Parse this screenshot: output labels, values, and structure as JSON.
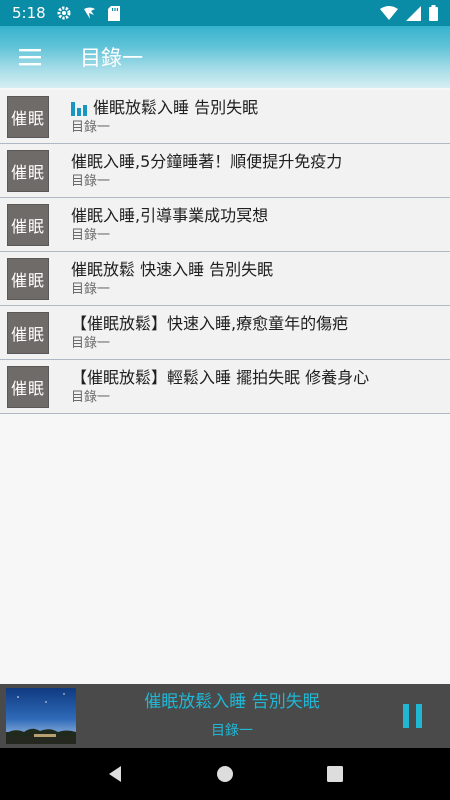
{
  "status_bar": {
    "time": "5:18",
    "icons": [
      "gear-icon",
      "bird-icon",
      "sd-card-icon",
      "wifi-icon",
      "signal-icon",
      "battery-icon"
    ]
  },
  "app_bar": {
    "title": "目錄一",
    "menu_icon": "hamburger-icon"
  },
  "list": {
    "items": [
      {
        "thumb": "催眠",
        "title": "催眠放鬆入睡 告別失眠",
        "subtitle": "目錄一",
        "playing": true
      },
      {
        "thumb": "催眠",
        "title": "催眠入睡,5分鐘睡著！順便提升免疫力",
        "subtitle": "目錄一",
        "playing": false
      },
      {
        "thumb": "催眠",
        "title": "催眠入睡,引導事業成功冥想",
        "subtitle": "目錄一",
        "playing": false
      },
      {
        "thumb": "催眠",
        "title": "催眠放鬆 快速入睡 告別失眠",
        "subtitle": "目錄一",
        "playing": false
      },
      {
        "thumb": "催眠",
        "title": "【催眠放鬆】快速入睡,療愈童年的傷疤",
        "subtitle": "目錄一",
        "playing": false
      },
      {
        "thumb": "催眠",
        "title": "【催眠放鬆】輕鬆入睡 擺拍失眠 修養身心",
        "subtitle": "目錄一",
        "playing": false
      }
    ]
  },
  "player": {
    "title": "催眠放鬆入睡 告別失眠",
    "subtitle": "目錄一",
    "accent_color": "#1fb7d4",
    "control_icon": "pause-icon"
  },
  "nav_bar": {
    "icons": [
      "back-icon",
      "home-icon",
      "recents-icon"
    ]
  }
}
